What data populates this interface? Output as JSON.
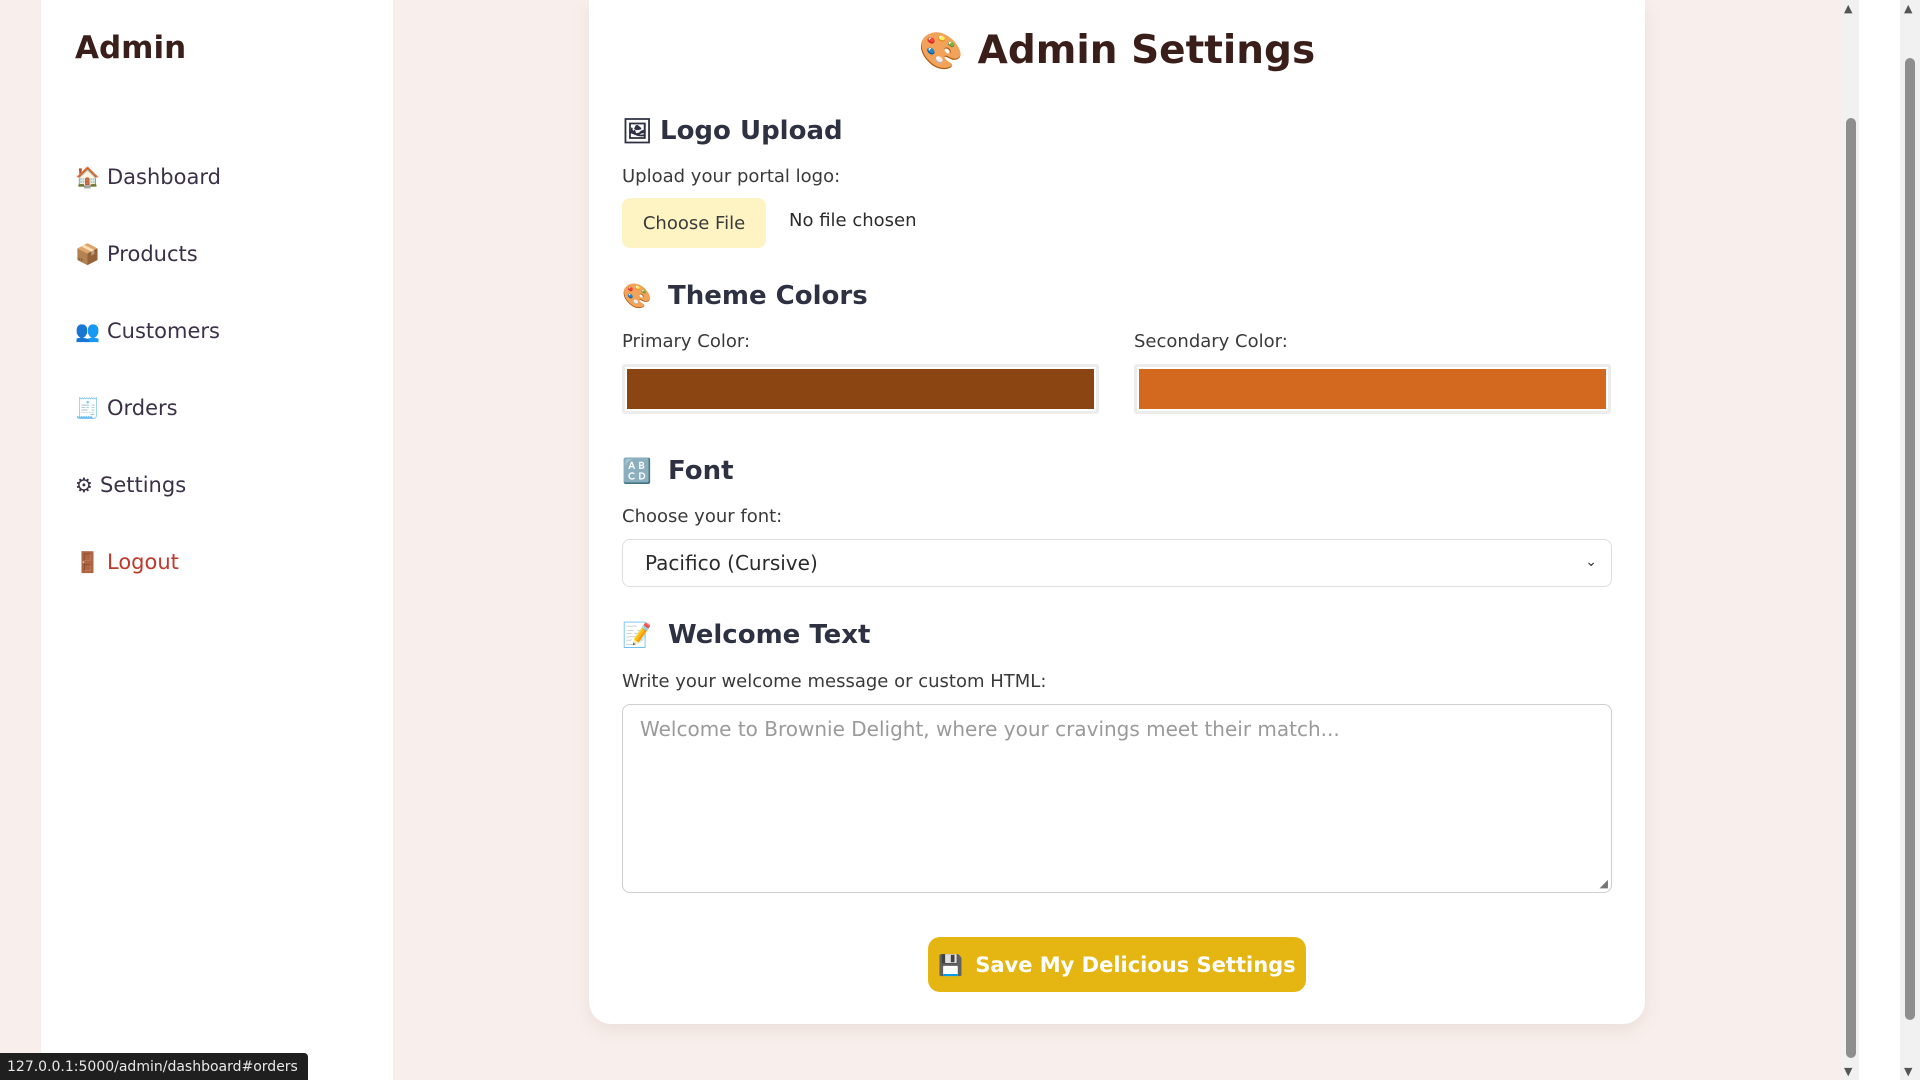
{
  "sidebar": {
    "brand": "Admin",
    "items": [
      {
        "icon": "house-icon",
        "glyph": "🏠",
        "label": "Dashboard"
      },
      {
        "icon": "package-icon",
        "glyph": "📦",
        "label": "Products"
      },
      {
        "icon": "people-icon",
        "glyph": "👥",
        "label": "Customers"
      },
      {
        "icon": "receipt-icon",
        "glyph": "🧾",
        "label": "Orders"
      },
      {
        "icon": "gear-icon",
        "glyph": "⚙",
        "label": "Settings"
      },
      {
        "icon": "door-icon",
        "glyph": "🚪",
        "label": "Logout"
      }
    ]
  },
  "main": {
    "title_icon": "🎨",
    "title": "Admin Settings",
    "logo": {
      "icon": "🖼",
      "heading": "Logo Upload",
      "label": "Upload your portal logo:",
      "button": "Choose File",
      "status": "No file chosen"
    },
    "theme": {
      "icon": "🎨",
      "heading": "Theme Colors",
      "primary_label": "Primary Color:",
      "primary_value": "#8B4513",
      "secondary_label": "Secondary Color:",
      "secondary_value": "#D2691E"
    },
    "font": {
      "icon": "🔠",
      "heading": "Font",
      "label": "Choose your font:",
      "selected": "Pacifico (Cursive)"
    },
    "welcome": {
      "icon": "📝",
      "heading": "Welcome Text",
      "label": "Write your welcome message or custom HTML:",
      "placeholder": "Welcome to Brownie Delight, where your cravings meet their match..."
    },
    "save": {
      "icon": "💾",
      "label": "Save My Delicious Settings"
    }
  },
  "status_url": "127.0.0.1:5000/admin/dashboard#orders"
}
